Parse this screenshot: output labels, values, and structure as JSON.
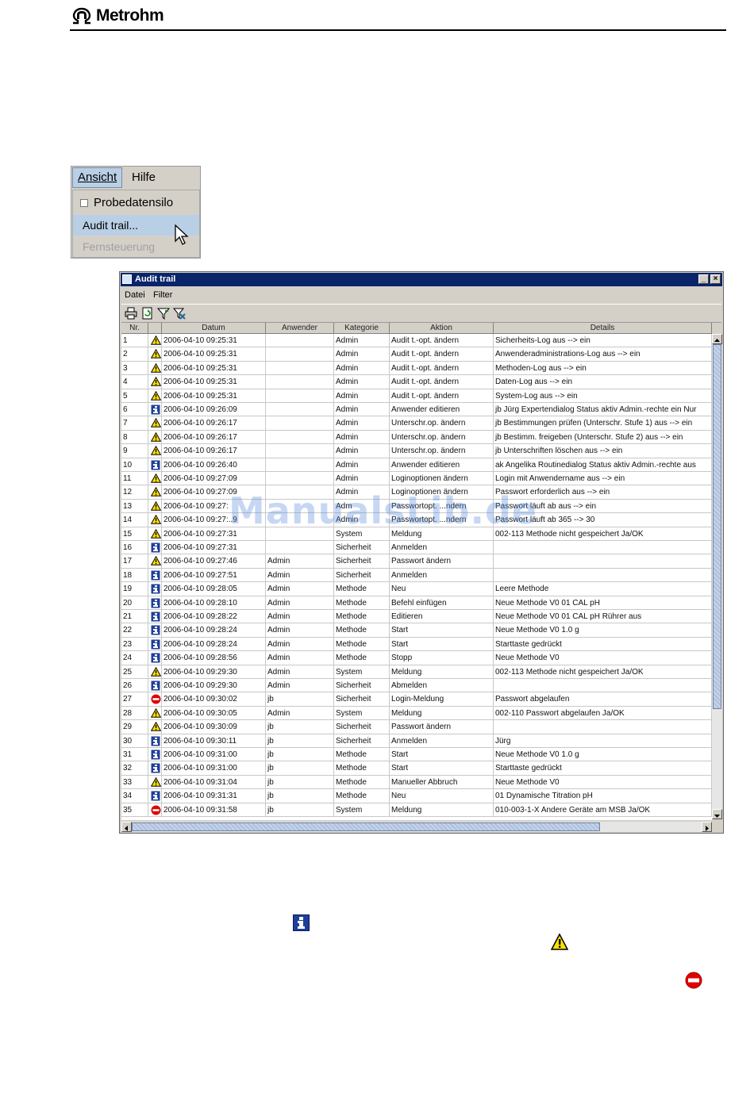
{
  "brand": {
    "name": "Metrohm"
  },
  "menu": {
    "items": [
      {
        "label": "Ansicht"
      },
      {
        "label": "Hilfe"
      }
    ],
    "dropdown": [
      {
        "label": "Probedatensilo",
        "type": "checkbox",
        "checked": false
      },
      {
        "label": "Audit trail...",
        "state": "highlighted"
      },
      {
        "label": "Fernsteuerung",
        "state": "disabled"
      }
    ]
  },
  "audit_window": {
    "title": "Audit trail",
    "menu": [
      {
        "label": "Datei"
      },
      {
        "label": "Filter"
      }
    ],
    "toolbar_icons": [
      "print-icon",
      "refresh-icon",
      "filter-icon",
      "clear-filter-icon"
    ],
    "columns": [
      "Nr.",
      "",
      "Datum",
      "Anwender",
      "Kategorie",
      "Aktion",
      "Details"
    ],
    "rows": [
      {
        "nr": "1",
        "icon": "warning",
        "datum": "2006-04-10 09:25:31",
        "anwender": "",
        "kategorie": "Admin",
        "aktion": "Audit t.-opt. ändern",
        "details": "Sicherheits-Log aus --> ein"
      },
      {
        "nr": "2",
        "icon": "warning",
        "datum": "2006-04-10 09:25:31",
        "anwender": "",
        "kategorie": "Admin",
        "aktion": "Audit t.-opt. ändern",
        "details": "Anwenderadministrations-Log aus --> ein"
      },
      {
        "nr": "3",
        "icon": "warning",
        "datum": "2006-04-10 09:25:31",
        "anwender": "",
        "kategorie": "Admin",
        "aktion": "Audit t.-opt. ändern",
        "details": "Methoden-Log aus --> ein"
      },
      {
        "nr": "4",
        "icon": "warning",
        "datum": "2006-04-10 09:25:31",
        "anwender": "",
        "kategorie": "Admin",
        "aktion": "Audit t.-opt. ändern",
        "details": "Daten-Log aus --> ein"
      },
      {
        "nr": "5",
        "icon": "warning",
        "datum": "2006-04-10 09:25:31",
        "anwender": "",
        "kategorie": "Admin",
        "aktion": "Audit t.-opt. ändern",
        "details": "System-Log aus --> ein"
      },
      {
        "nr": "6",
        "icon": "info",
        "datum": "2006-04-10 09:26:09",
        "anwender": "",
        "kategorie": "Admin",
        "aktion": "Anwender editieren",
        "details": "jb Jürg Expertendialog Status aktiv Admin.-rechte ein Nur"
      },
      {
        "nr": "7",
        "icon": "warning",
        "datum": "2006-04-10 09:26:17",
        "anwender": "",
        "kategorie": "Admin",
        "aktion": "Unterschr.op. ändern",
        "details": "jb Bestimmungen prüfen (Unterschr. Stufe 1) aus --> ein"
      },
      {
        "nr": "8",
        "icon": "warning",
        "datum": "2006-04-10 09:26:17",
        "anwender": "",
        "kategorie": "Admin",
        "aktion": "Unterschr.op. ändern",
        "details": "jb Bestimm. freigeben (Unterschr. Stufe 2) aus --> ein"
      },
      {
        "nr": "9",
        "icon": "warning",
        "datum": "2006-04-10 09:26:17",
        "anwender": "",
        "kategorie": "Admin",
        "aktion": "Unterschr.op. ändern",
        "details": "jb Unterschriften löschen aus --> ein"
      },
      {
        "nr": "10",
        "icon": "info",
        "datum": "2006-04-10 09:26:40",
        "anwender": "",
        "kategorie": "Admin",
        "aktion": "Anwender editieren",
        "details": "ak Angelika Routinedialog Status aktiv Admin.-rechte aus"
      },
      {
        "nr": "11",
        "icon": "warning",
        "datum": "2006-04-10 09:27:09",
        "anwender": "",
        "kategorie": "Admin",
        "aktion": "Loginoptionen ändern",
        "details": "Login mit Anwendername aus --> ein"
      },
      {
        "nr": "12",
        "icon": "warning",
        "datum": "2006-04-10 09:27:09",
        "anwender": "",
        "kategorie": "Admin",
        "aktion": "Loginoptionen ändern",
        "details": "Passwort erforderlich aus --> ein"
      },
      {
        "nr": "13",
        "icon": "warning",
        "datum": "2006-04-10 09:27:",
        "anwender": "",
        "kategorie": "Adm",
        "aktion": "Passwortopt. ...ndern",
        "details": "Passwort läuft ab aus --> ein"
      },
      {
        "nr": "14",
        "icon": "warning",
        "datum": "2006-04-10 09:27:..9",
        "anwender": "",
        "kategorie": "Admin",
        "aktion": "Passwortopt. ...ndern",
        "details": "Passwort läuft ab 365 --> 30"
      },
      {
        "nr": "15",
        "icon": "warning",
        "datum": "2006-04-10 09:27:31",
        "anwender": "",
        "kategorie": "System",
        "aktion": "Meldung",
        "details": "002-113 Methode nicht gespeichert Ja/OK"
      },
      {
        "nr": "16",
        "icon": "info",
        "datum": "2006-04-10 09:27:31",
        "anwender": "",
        "kategorie": "Sicherheit",
        "aktion": "Anmelden",
        "details": ""
      },
      {
        "nr": "17",
        "icon": "warning",
        "datum": "2006-04-10 09:27:46",
        "anwender": "Admin",
        "kategorie": "Sicherheit",
        "aktion": "Passwort ändern",
        "details": ""
      },
      {
        "nr": "18",
        "icon": "info",
        "datum": "2006-04-10 09:27:51",
        "anwender": "Admin",
        "kategorie": "Sicherheit",
        "aktion": "Anmelden",
        "details": ""
      },
      {
        "nr": "19",
        "icon": "info",
        "datum": "2006-04-10 09:28:05",
        "anwender": "Admin",
        "kategorie": "Methode",
        "aktion": "Neu",
        "details": "Leere Methode"
      },
      {
        "nr": "20",
        "icon": "info",
        "datum": "2006-04-10 09:28:10",
        "anwender": "Admin",
        "kategorie": "Methode",
        "aktion": "Befehl einfügen",
        "details": "Neue Methode V0 01 CAL pH"
      },
      {
        "nr": "21",
        "icon": "info",
        "datum": "2006-04-10 09:28:22",
        "anwender": "Admin",
        "kategorie": "Methode",
        "aktion": "Editieren",
        "details": "Neue Methode V0 01 CAL pH Rührer aus"
      },
      {
        "nr": "22",
        "icon": "info",
        "datum": "2006-04-10 09:28:24",
        "anwender": "Admin",
        "kategorie": "Methode",
        "aktion": "Start",
        "details": "Neue Methode V0   1.0 g"
      },
      {
        "nr": "23",
        "icon": "info",
        "datum": "2006-04-10 09:28:24",
        "anwender": "Admin",
        "kategorie": "Methode",
        "aktion": "Start",
        "details": "Starttaste gedrückt"
      },
      {
        "nr": "24",
        "icon": "info",
        "datum": "2006-04-10 09:28:56",
        "anwender": "Admin",
        "kategorie": "Methode",
        "aktion": "Stopp",
        "details": "Neue Methode V0"
      },
      {
        "nr": "25",
        "icon": "warning",
        "datum": "2006-04-10 09:29:30",
        "anwender": "Admin",
        "kategorie": "System",
        "aktion": "Meldung",
        "details": "002-113 Methode nicht gespeichert Ja/OK"
      },
      {
        "nr": "26",
        "icon": "info",
        "datum": "2006-04-10 09:29:30",
        "anwender": "Admin",
        "kategorie": "Sicherheit",
        "aktion": "Abmelden",
        "details": ""
      },
      {
        "nr": "27",
        "icon": "error",
        "datum": "2006-04-10 09:30:02",
        "anwender": "jb",
        "kategorie": "Sicherheit",
        "aktion": "Login-Meldung",
        "details": "Passwort abgelaufen"
      },
      {
        "nr": "28",
        "icon": "warning",
        "datum": "2006-04-10 09:30:05",
        "anwender": "Admin",
        "kategorie": "System",
        "aktion": "Meldung",
        "details": "002-110 Passwort abgelaufen Ja/OK"
      },
      {
        "nr": "29",
        "icon": "warning",
        "datum": "2006-04-10 09:30:09",
        "anwender": "jb",
        "kategorie": "Sicherheit",
        "aktion": "Passwort ändern",
        "details": ""
      },
      {
        "nr": "30",
        "icon": "info",
        "datum": "2006-04-10 09:30:11",
        "anwender": "jb",
        "kategorie": "Sicherheit",
        "aktion": "Anmelden",
        "details": "Jürg"
      },
      {
        "nr": "31",
        "icon": "info",
        "datum": "2006-04-10 09:31:00",
        "anwender": "jb",
        "kategorie": "Methode",
        "aktion": "Start",
        "details": "Neue Methode V0   1.0 g"
      },
      {
        "nr": "32",
        "icon": "info",
        "datum": "2006-04-10 09:31:00",
        "anwender": "jb",
        "kategorie": "Methode",
        "aktion": "Start",
        "details": "Starttaste gedrückt"
      },
      {
        "nr": "33",
        "icon": "warning",
        "datum": "2006-04-10 09:31:04",
        "anwender": "jb",
        "kategorie": "Methode",
        "aktion": "Manueller Abbruch",
        "details": "Neue Methode V0"
      },
      {
        "nr": "34",
        "icon": "info",
        "datum": "2006-04-10 09:31:31",
        "anwender": "jb",
        "kategorie": "Methode",
        "aktion": "Neu",
        "details": "01 Dynamische Titration pH"
      },
      {
        "nr": "35",
        "icon": "error",
        "datum": "2006-04-10 09:31:58",
        "anwender": "jb",
        "kategorie": "System",
        "aktion": "Meldung",
        "details": "010-003-1-X Andere Geräte am MSB Ja/OK"
      }
    ]
  },
  "watermark": "ManualsLib.de",
  "colors": {
    "titlebar": "#0a246a",
    "menu_highlight": "#b8cfe5",
    "info_icon": "#1f3f9a",
    "warning_icon": "#ffe000",
    "error_icon": "#e00000"
  }
}
